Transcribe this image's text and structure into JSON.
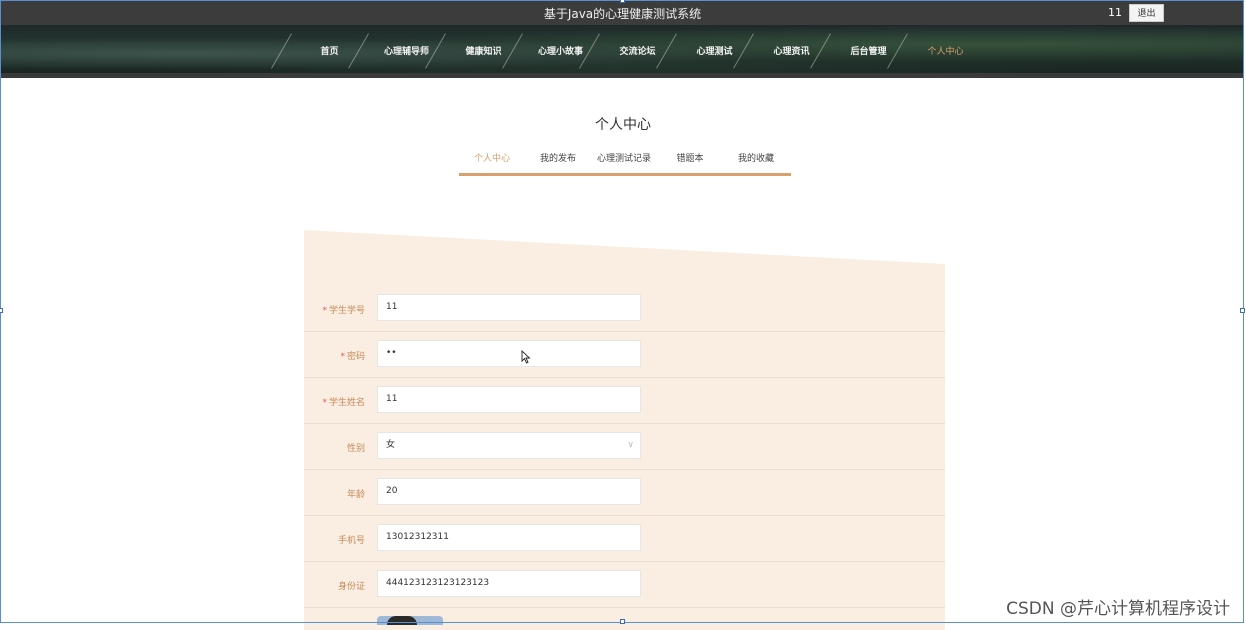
{
  "header": {
    "site_title": "基于Java的心理健康测试系统",
    "user_name": "11",
    "logout_label": "退出"
  },
  "nav": {
    "items": [
      {
        "label": "首页"
      },
      {
        "label": "心理辅导师"
      },
      {
        "label": "健康知识"
      },
      {
        "label": "心理小故事"
      },
      {
        "label": "交流论坛"
      },
      {
        "label": "心理测试"
      },
      {
        "label": "心理资讯"
      },
      {
        "label": "后台管理"
      },
      {
        "label": "个人中心"
      }
    ],
    "active_index": 8
  },
  "page": {
    "title": "个人中心",
    "tabs": [
      {
        "label": "个人中心"
      },
      {
        "label": "我的发布"
      },
      {
        "label": "心理测试记录"
      },
      {
        "label": "错题本"
      },
      {
        "label": "我的收藏"
      }
    ],
    "active_tab": 0
  },
  "form": {
    "fields": [
      {
        "label": "学生学号",
        "required": true,
        "value": "11"
      },
      {
        "label": "密码",
        "required": true,
        "value": "••"
      },
      {
        "label": "学生姓名",
        "required": true,
        "value": "11"
      },
      {
        "label": "性别",
        "required": false,
        "value": "女",
        "type": "select"
      },
      {
        "label": "年龄",
        "required": false,
        "value": "20"
      },
      {
        "label": "手机号",
        "required": false,
        "value": "13012312311"
      },
      {
        "label": "身份证",
        "required": false,
        "value": "444123123123123123"
      }
    ],
    "required_mark": "*"
  },
  "colors": {
    "accent": "#d9a06b",
    "panel_bg": "#faeee3",
    "topbar_bg": "#3c3c3c"
  },
  "watermark": "CSDN @芹心计算机程序设计"
}
